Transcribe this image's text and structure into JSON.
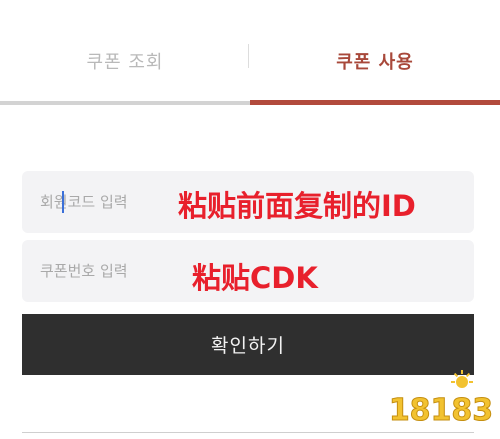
{
  "tabs": {
    "lookup": {
      "label": "쿠폰 조회"
    },
    "use": {
      "label": "쿠폰 사용"
    }
  },
  "form": {
    "member_code": {
      "placeholder": "회원코드 입력",
      "value": ""
    },
    "coupon_number": {
      "placeholder": "쿠폰번호 입력",
      "value": ""
    },
    "confirm_label": "확인하기"
  },
  "annotations": {
    "member_code_note": "粘贴前面复制的ID",
    "coupon_note": "粘贴CDK"
  },
  "watermark": {
    "text": "18183"
  },
  "colors": {
    "accent": "#b24a3c",
    "annotation": "#e8202c",
    "button_bg": "#2f2f2f",
    "field_bg": "#f3f3f5",
    "watermark": "#f2c230"
  }
}
